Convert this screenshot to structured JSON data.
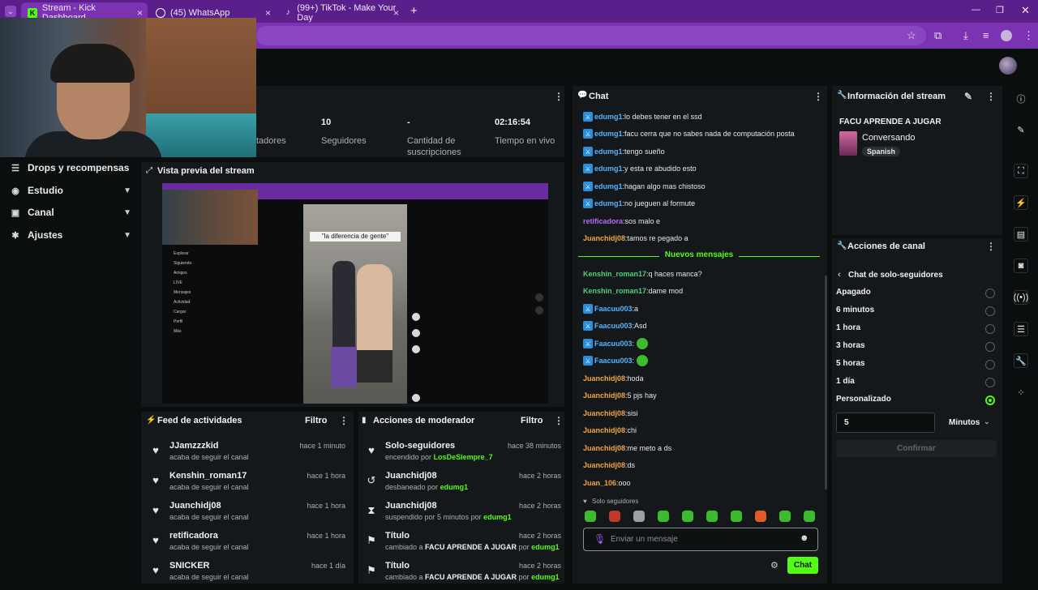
{
  "browser": {
    "tabs": [
      {
        "label": "Stream - Kick Dashboard",
        "icon": "K",
        "active": true
      },
      {
        "label": "(45) WhatsApp",
        "icon": "whatsapp-icon",
        "active": false
      },
      {
        "label": "(99+) TikTok - Make Your Day",
        "icon": "tiktok-icon",
        "active": false
      }
    ],
    "new_tab": "+"
  },
  "sidebar": {
    "items": [
      {
        "label": "Drops y recompensas",
        "icon": "drops-icon"
      },
      {
        "label": "Estudio",
        "icon": "studio-icon"
      },
      {
        "label": "Canal",
        "icon": "channel-icon"
      },
      {
        "label": "Ajustes",
        "icon": "gear-icon"
      }
    ]
  },
  "stats": [
    {
      "value": "",
      "label": "tadores"
    },
    {
      "value": "10",
      "label": "Seguidores"
    },
    {
      "value": "-",
      "label": "Cantidad de suscripciones"
    },
    {
      "value": "02:16:54",
      "label": "Tiempo en vivo"
    }
  ],
  "preview": {
    "title": "Vista previa del stream",
    "video_caption": "\"la diferencia de gente\""
  },
  "activity_feed": {
    "title": "Feed de actividades",
    "filter": "Filtro",
    "rows": [
      {
        "name": "JJamzzzkid",
        "sub": "acaba de seguir el canal",
        "time": "hace 1 minuto"
      },
      {
        "name": "Kenshin_roman17",
        "sub": "acaba de seguir el canal",
        "time": "hace 1 hora"
      },
      {
        "name": "Juanchidj08",
        "sub": "acaba de seguir el canal",
        "time": "hace 1 hora"
      },
      {
        "name": "retificadora",
        "sub": "acaba de seguir el canal",
        "time": "hace 1 hora"
      },
      {
        "name": "SNICKER",
        "sub": "acaba de seguir el canal",
        "time": "hace 1 día"
      }
    ]
  },
  "mod_actions": {
    "title": "Acciones de moderador",
    "filter": "Filtro",
    "rows": [
      {
        "name": "Solo-seguidores",
        "pre": "encendido por",
        "who": "LosDeSiempre_7",
        "mid": "",
        "post": "",
        "time": "hace 38 minutos"
      },
      {
        "name": "Juanchidj08",
        "pre": "desbaneado por",
        "who": "edumg1",
        "mid": "",
        "post": "",
        "time": "hace 2 horas"
      },
      {
        "name": "Juanchidj08",
        "pre": "suspendido por 5 minutos por",
        "who": "edumg1",
        "mid": "",
        "post": "",
        "time": "hace 2 horas"
      },
      {
        "name": "Título",
        "pre": "cambiado a",
        "mid": "FACU APRENDE A JUGAR",
        "post": "por",
        "who": "edumg1",
        "time": "hace 2 horas"
      },
      {
        "name": "Título",
        "pre": "cambiado a",
        "mid": "FACU APRENDE A JUGAR",
        "post": "por",
        "who": "edumg1",
        "time": "hace 2 horas"
      }
    ]
  },
  "chat": {
    "title": "Chat",
    "new_messages": "Nuevos mensajes",
    "messages": [
      {
        "user": "edumg1",
        "color": "#53b4ff",
        "badge": true,
        "text": "lo debes tener en el ssd"
      },
      {
        "user": "edumg1",
        "color": "#53b4ff",
        "badge": true,
        "text": "facu cerra que no sabes nada de computación posta"
      },
      {
        "user": "edumg1",
        "color": "#53b4ff",
        "badge": true,
        "text": "tengo sueño"
      },
      {
        "user": "edumg1",
        "color": "#53b4ff",
        "badge": true,
        "text": "y esta re abudido esto"
      },
      {
        "user": "edumg1",
        "color": "#53b4ff",
        "badge": true,
        "text": "hagan algo mas chistoso"
      },
      {
        "user": "edumg1",
        "color": "#53b4ff",
        "badge": true,
        "text": "no jueguen al formute"
      },
      {
        "user": "retificadora",
        "color": "#b26bff",
        "badge": false,
        "text": "sos malo e"
      },
      {
        "user": "Juanchidj08",
        "color": "#f0a640",
        "badge": false,
        "text": "tamos re pegado a"
      },
      {
        "user": "Kenshin_roman17",
        "color": "#4dd17a",
        "badge": false,
        "text": "q haces manca?"
      },
      {
        "user": "Kenshin_roman17",
        "color": "#4dd17a",
        "badge": false,
        "text": "dame mod"
      },
      {
        "user": "Faacuu003",
        "color": "#53b4ff",
        "badge": true,
        "text": "a"
      },
      {
        "user": "Faacuu003",
        "color": "#53b4ff",
        "badge": true,
        "text": "Asd"
      },
      {
        "user": "Faacuu003",
        "color": "#53b4ff",
        "badge": true,
        "text": "",
        "emote": true
      },
      {
        "user": "Faacuu003",
        "color": "#53b4ff",
        "badge": true,
        "text": "",
        "emote": true
      },
      {
        "user": "Juanchidj08",
        "color": "#f0a640",
        "badge": false,
        "text": "hoda"
      },
      {
        "user": "Juanchidj08",
        "color": "#f0a640",
        "badge": false,
        "text": "5 pjs hay"
      },
      {
        "user": "Juanchidj08",
        "color": "#f0a640",
        "badge": false,
        "text": "sisi"
      },
      {
        "user": "Juanchidj08",
        "color": "#f0a640",
        "badge": false,
        "text": "chi"
      },
      {
        "user": "Juanchidj08",
        "color": "#f0a640",
        "badge": false,
        "text": "me meto a ds"
      },
      {
        "user": "Juanchidj08",
        "color": "#f0a640",
        "badge": false,
        "text": "ds"
      },
      {
        "user": "Juan_106",
        "color": "#f0a640",
        "badge": false,
        "text": "ooo"
      }
    ],
    "mode": "Solo seguidores",
    "input_placeholder": "Enviar un mensaje",
    "send": "Chat"
  },
  "stream_info": {
    "title": "Información del stream",
    "stream_title": "FACU APRENDE A JUGAR",
    "category": "Conversando",
    "language": "Spanish"
  },
  "channel_actions": {
    "title": "Acciones de canal",
    "subtitle": "Chat de solo-seguidores",
    "options": [
      {
        "label": "Apagado",
        "on": false
      },
      {
        "label": "6 minutos",
        "on": false
      },
      {
        "label": "1 hora",
        "on": false
      },
      {
        "label": "3 horas",
        "on": false
      },
      {
        "label": "5 horas",
        "on": false
      },
      {
        "label": "1 día",
        "on": false
      },
      {
        "label": "Personalizado",
        "on": true
      }
    ],
    "custom_value": "5",
    "unit": "Minutos",
    "confirm": "Confirmar"
  },
  "colors": {
    "accent": "#53fc18",
    "tabbar": "#5a1f8a",
    "panel": "#15181a"
  }
}
